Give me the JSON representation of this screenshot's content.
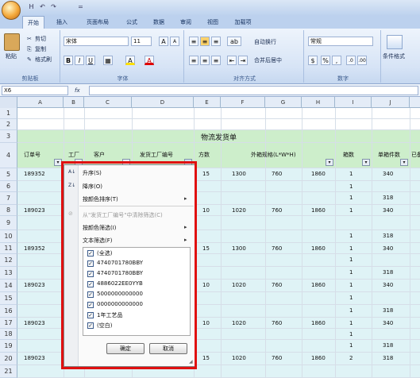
{
  "app": {
    "quick_access": [
      "H",
      "↶",
      "↷",
      "="
    ],
    "tabs": [
      "开始",
      "插入",
      "页面布局",
      "公式",
      "数据",
      "审阅",
      "视图",
      "加载项"
    ],
    "active_tab": "开始"
  },
  "ribbon": {
    "clipboard": {
      "paste": "粘贴",
      "cut": "剪切",
      "copy": "复制",
      "format_painter": "格式刷",
      "label": "剪贴板"
    },
    "font": {
      "name": "宋体",
      "size": "11",
      "bold": "B",
      "italic": "I",
      "underline": "U",
      "grow": "A",
      "shrink": "A",
      "fill": "A",
      "color": "A",
      "label": "字体"
    },
    "alignment": {
      "wrap": "自动换行",
      "merge": "合并后居中",
      "label": "对齐方式"
    },
    "number": {
      "format": "常规",
      "percent": "%",
      "comma": ",",
      "label": "数字"
    },
    "styles": {
      "conditional": "条件格式"
    }
  },
  "formula_bar": {
    "name_box": "X6",
    "fx": "fx",
    "value": ""
  },
  "columns": [
    "A",
    "B",
    "C",
    "D",
    "E",
    "F",
    "G",
    "H",
    "I",
    "J"
  ],
  "rows": [
    "1",
    "2",
    "3",
    "4",
    "5",
    "6",
    "7",
    "8",
    "9",
    "10",
    "11",
    "12",
    "13",
    "14",
    "15",
    "16",
    "17",
    "18",
    "19",
    "20",
    "21"
  ],
  "sheet": {
    "title": "物流发货单",
    "headers": {
      "a": "订单号",
      "b": "工厂",
      "c": "客户",
      "d": "发货工厂编号",
      "e": "方数",
      "fgh": "外箱规格(L*W*H)",
      "i": "箱数",
      "j": "单箱件数",
      "k": "已备"
    },
    "rows": [
      {
        "a": "189352",
        "e": "15",
        "f": "1300",
        "g": "760",
        "h": "1860",
        "i": "1",
        "j": "340"
      },
      {
        "i": "1"
      },
      {
        "i": "1",
        "j": "318"
      },
      {
        "a": "189023",
        "e": "10",
        "f": "1020",
        "g": "760",
        "h": "1860",
        "i": "1",
        "j": "340"
      },
      {},
      {
        "i": "1",
        "j": "318"
      },
      {
        "a": "189352",
        "e": "15",
        "f": "1300",
        "g": "760",
        "h": "1860",
        "i": "1",
        "j": "340"
      },
      {
        "i": "1"
      },
      {
        "i": "1",
        "j": "318"
      },
      {
        "a": "189023",
        "e": "10",
        "f": "1020",
        "g": "760",
        "h": "1860",
        "i": "1",
        "j": "340"
      },
      {
        "i": "1"
      },
      {
        "i": "1",
        "j": "318"
      },
      {
        "a": "189023",
        "e": "10",
        "f": "1020",
        "g": "760",
        "h": "1860",
        "i": "1",
        "j": "340"
      },
      {
        "i": "1"
      },
      {
        "i": "1",
        "j": "318"
      },
      {
        "a": "189023",
        "e": "15",
        "f": "1020",
        "g": "760",
        "h": "1860",
        "i": "2",
        "j": "318"
      }
    ]
  },
  "filter_menu": {
    "sort_asc": "升序(S)",
    "sort_desc": "降序(O)",
    "sort_color": "按颜色排序(T)",
    "clear_filter": "从\"发货工厂编号\"中清除筛选(C)",
    "filter_color": "按颜色筛选(I)",
    "text_filter": "文本筛选(F)",
    "items": [
      "(全选)",
      "4740701780BBY",
      "4740701780BBY",
      "4886022EE0YYB",
      "5000000000000",
      "0000000000000",
      "1年工艺品",
      "(空白)"
    ],
    "ok": "确定",
    "cancel": "取消"
  }
}
